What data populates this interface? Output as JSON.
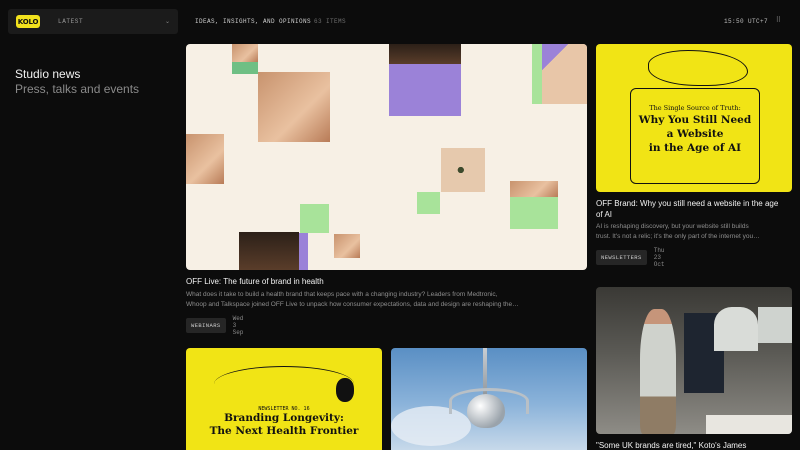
{
  "header": {
    "logo_text": "KOLO",
    "filter_label": "LATEST",
    "filter_chevron": "⌄",
    "section_title": "IDEAS, INSIGHTS, AND OPINIONS",
    "item_count": "63 ITEMS",
    "clock": "15:50 UTC+7",
    "grid_icon": "⠿"
  },
  "sidebar": {
    "heading": "Studio news",
    "subheading": "Press, talks and events"
  },
  "cards": [
    {
      "title": "OFF Live: The future of brand in health",
      "description_line1": "What does it take to build a health brand that keeps pace with a changing industry? Leaders from Medtronic,",
      "description_line2": "Whoop and Talkspace joined OFF Live to unpack how consumer expectations, data and design are reshaping the…",
      "tag": "WEBINARS",
      "date": "Wed 3 Sep"
    },
    {
      "title_line1": "OFF Brand: Why you still need a website in the age",
      "title_line2": "of AI",
      "description_line1": "AI is reshaping discovery, but your website still builds",
      "description_line2": "trust. It's not a relic; it's the only part of the internet you…",
      "tag": "NEWSLETTERS",
      "date": "Thu 23 Oct",
      "art_small": "The Single Source of Truth:",
      "art_line1": "Why You Still Need",
      "art_line2": "a Website",
      "art_line3": "in the Age of AI"
    },
    {
      "art_kicker": "NEWSLETTER NO. 16",
      "art_line1": "Branding Longevity:",
      "art_line2": "The Next Health Frontier"
    },
    {
      "alt": "silver heart sculpture"
    },
    {
      "title": "\"Some UK brands are tired,\" Koto's James"
    }
  ],
  "colors": {
    "background": "#0c0c0c",
    "accent_yellow": "#f1e415",
    "purple": "#9b82d8",
    "green": "#a8e39a"
  }
}
